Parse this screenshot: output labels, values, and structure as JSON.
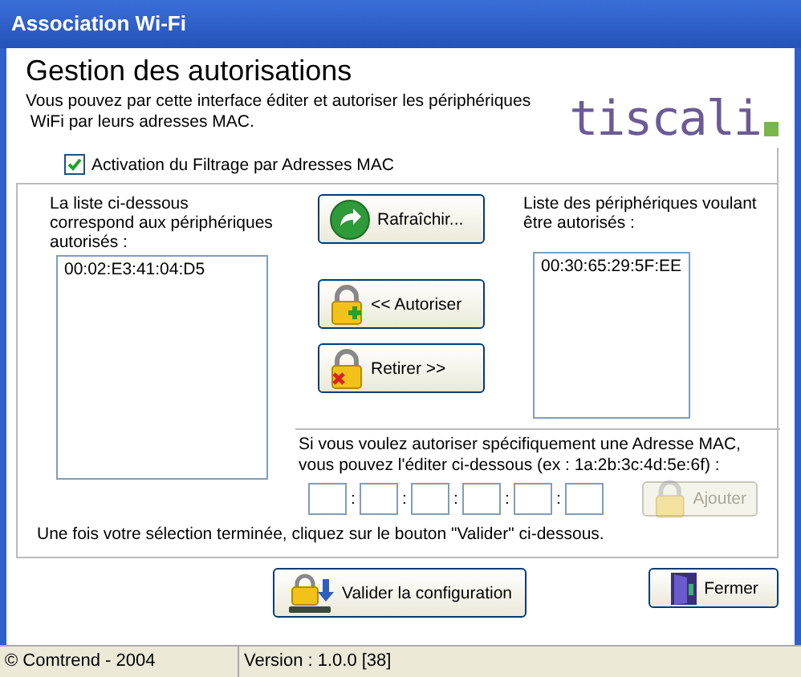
{
  "window": {
    "title": "Association Wi-Fi"
  },
  "header": {
    "title": "Gestion des autorisations",
    "description": "Vous pouvez par cette interface éditer et autoriser les périphériques\n WiFi par leurs adresses MAC.",
    "logo": "tiscali"
  },
  "filter_checkbox": {
    "label": "Activation du Filtrage par Adresses MAC",
    "checked": true
  },
  "authorized": {
    "label": "La liste ci-dessous correspond aux périphériques autorisés :",
    "items": [
      "00:02:E3:41:04:D5"
    ]
  },
  "pending": {
    "label": "Liste des périphériques voulant être autorisés :",
    "items": [
      "00:30:65:29:5F:EE"
    ]
  },
  "actions": [
    {
      "label": "Rafraîchir...",
      "kind": "refresh"
    },
    {
      "label": "<< Autoriser",
      "kind": "add"
    },
    {
      "label": "Retirer >>",
      "kind": "remove"
    }
  ],
  "manual": {
    "label": "Si vous voulez autoriser spécifiquement une Adresse MAC, vous pouvez l'éditer ci-dessous (ex : 1a:2b:3c:4d:5e:6f) :",
    "separator": ":",
    "add_button": {
      "label": "Ajouter",
      "disabled": true
    }
  },
  "hint": "Une fois votre sélection terminée, cliquez sur le bouton \"Valider\" ci-dessous.",
  "buttons": [
    {
      "label": "Valider la configuration",
      "kind": "validate"
    },
    {
      "label": "Fermer",
      "kind": "close"
    }
  ],
  "status_bar": [
    "© Comtrend - 2004",
    "Version :  1.0.0 [38]"
  ]
}
